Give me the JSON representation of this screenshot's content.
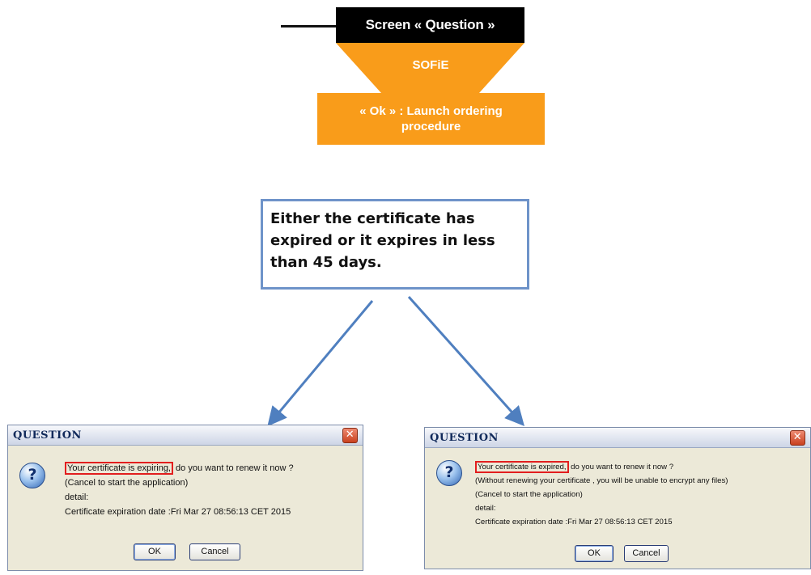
{
  "header": {
    "screen_label": "Screen « Question »",
    "system_label": "SOFiE",
    "action_label": "« Ok » : Launch ordering procedure"
  },
  "note": {
    "text": "Either the certificate has expired or it expires in less than 45 days."
  },
  "colors": {
    "header_bg": "#000000",
    "funnel_orange": "#f99c1a",
    "note_border": "#6e93c9",
    "arrow_blue": "#5080c0",
    "highlight_red": "#e21e1e"
  },
  "dialogs": [
    {
      "title": "QUESTION",
      "close_glyph": "✕",
      "icon": "question-icon",
      "highlight": "Your certificate is expiring,",
      "line1_rest": " do you want to renew it now ?",
      "lines": [
        "(Cancel to start the application)",
        "detail:",
        "Certificate expiration date :Fri Mar 27 08:56:13 CET 2015"
      ],
      "ok_label": "OK",
      "cancel_label": "Cancel"
    },
    {
      "title": "QUESTION",
      "close_glyph": "✕",
      "icon": "question-icon",
      "highlight": "Your certificate is expired,",
      "line1_rest": " do you want to renew it now ?",
      "lines": [
        "(Without renewing your certificate , you will be unable to encrypt any files)",
        "(Cancel to start the application)",
        "detail:",
        "Certificate expiration date :Fri Mar 27 08:56:13 CET 2015"
      ],
      "ok_label": "OK",
      "cancel_label": "Cancel"
    }
  ]
}
